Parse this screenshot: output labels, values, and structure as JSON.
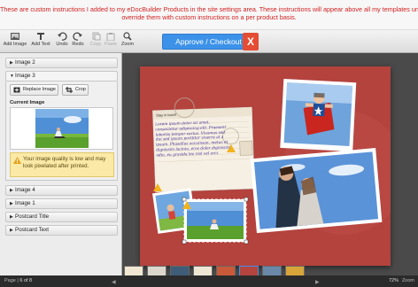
{
  "banner": {
    "line1": "These are custom instructions I added to my eDocBuilder Products in the site settings area. These instructions will appear above all my templates unless I specifically",
    "line2": "override them with custom instructions on a per product basis."
  },
  "toolbar": {
    "add_image": "Add Image",
    "add_text": "Add Text",
    "undo": "Undo",
    "redo": "Redo",
    "copy": "Copy",
    "paste": "Paste",
    "zoom": "Zoom",
    "approve_checkout": "Approve / Checkout",
    "close": "X"
  },
  "sidebar": {
    "image2": "Image 2",
    "image3": "Image 3",
    "replace_image": "Replace Image",
    "crop": "Crop",
    "current_image": "Current Image",
    "warning": "Your image quality is low and may look pixelated after printed.",
    "image4": "Image 4",
    "image1": "Image 1",
    "postcard_title": "Postcard Title",
    "postcard_text": "Postcard Text"
  },
  "postcard": {
    "header": "Stay in touch",
    "body": "Lorem ipsum dolor sit amet, consectetur adipiscing elit. Praesent lobortis tempor varius. Vivamus sed dui sed ipsum porttitor viverra at a ipsum. Phasellus accumsan, metus et dignissim lacinia, eros dolor dignissim odio, eu gravida leo nisl vel orci."
  },
  "footer": {
    "page_label": "Page",
    "page_value": "6 of 8",
    "zoom_value": "72%",
    "zoom_label": "Zoom"
  },
  "colors": {
    "banner_text": "#d11f1f",
    "approve": "#3c92e8",
    "close": "#e44c33",
    "card": "#b5433e"
  }
}
